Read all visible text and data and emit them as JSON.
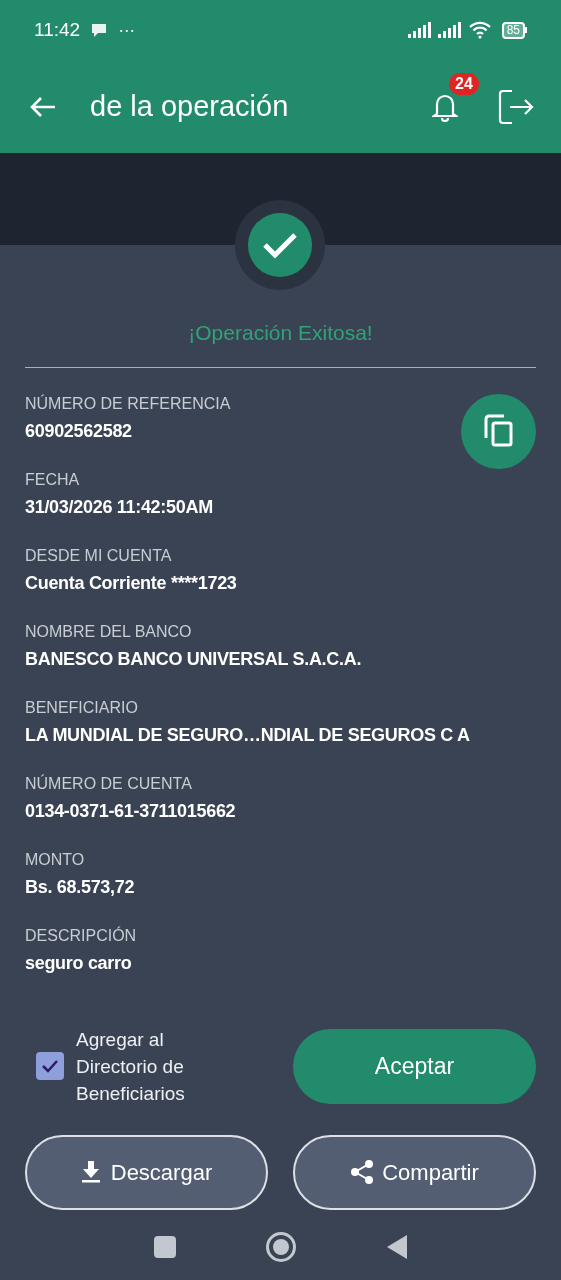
{
  "status_bar": {
    "time": "11:42",
    "more": "···",
    "battery": "85"
  },
  "header": {
    "title": "de la operación",
    "notifications": "24"
  },
  "result": {
    "message": "¡Operación Exitosa!"
  },
  "fields": [
    {
      "label": "NÚMERO DE REFERENCIA",
      "value": "60902562582"
    },
    {
      "label": "FECHA",
      "value": "31/03/2026 11:42:50AM"
    },
    {
      "label": "DESDE MI CUENTA",
      "value": "Cuenta Corriente ****1723"
    },
    {
      "label": "NOMBRE DEL BANCO",
      "value": "BANESCO BANCO UNIVERSAL S.A.C.A."
    },
    {
      "label": "BENEFICIARIO",
      "value": "LA MUNDIAL DE SEGURO…NDIAL DE SEGUROS C A"
    },
    {
      "label": "NÚMERO DE CUENTA",
      "value": "0134-0371-61-3711015662"
    },
    {
      "label": "MONTO",
      "value": "Bs. 68.573,72"
    },
    {
      "label": "DESCRIPCIÓN",
      "value": "seguro carro"
    }
  ],
  "add_to_directory": {
    "label": "Agregar al Directorio de Beneficiarios",
    "checked": true
  },
  "buttons": {
    "accept": "Aceptar",
    "download": "Descargar",
    "share": "Compartir"
  }
}
